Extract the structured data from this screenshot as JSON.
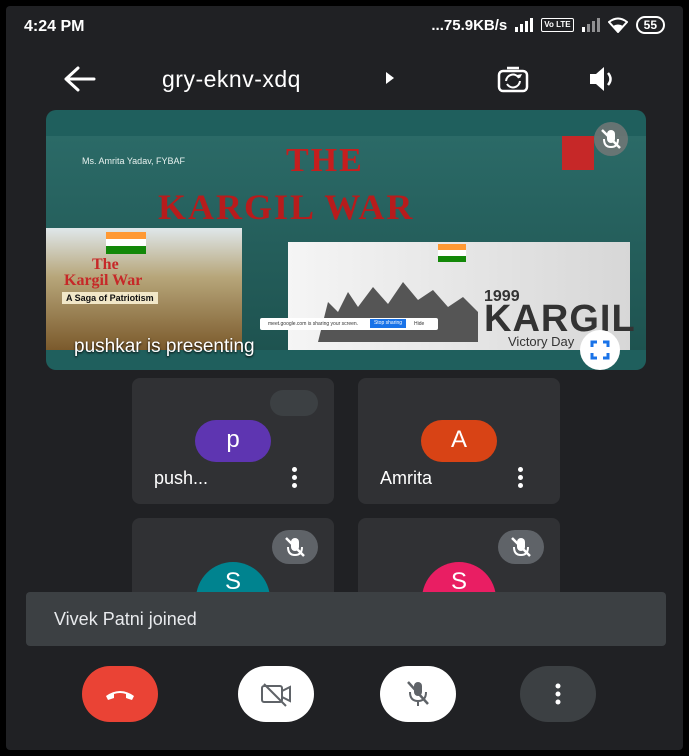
{
  "status_bar": {
    "time": "4:24 PM",
    "network_speed": "...75.9KB/s",
    "volte": "Vo LTE",
    "battery": "55"
  },
  "app_bar": {
    "meeting_code": "gry-eknv-xdq"
  },
  "presentation": {
    "slide_author": "Ms. Amrita Yadav, FYBAF",
    "slide_title_line1": "THE",
    "slide_title_line2": "KARGIL WAR",
    "poster_left_line1": "The",
    "poster_left_line2": "Kargil War",
    "poster_left_line3": "A Saga of Patriotism",
    "poster_right_year": "1999",
    "poster_right_title": "KARGIL",
    "poster_right_subtitle": "Victory Day",
    "share_bar_text": "meet.google.com is sharing your screen.",
    "share_bar_button": "Stop sharing",
    "share_bar_hide": "Hide",
    "presenting_label": "pushkar is presenting"
  },
  "participants": [
    {
      "initial": "p",
      "name": "push...",
      "color": "#5e35b1"
    },
    {
      "initial": "A",
      "name": "Amrita",
      "color": "#d84315"
    },
    {
      "initial": "S",
      "name": "",
      "color": "#00838f"
    },
    {
      "initial": "S",
      "name": "",
      "color": "#e91e63"
    }
  ],
  "toast": {
    "message": "Vivek Patni joined"
  },
  "icons": [
    "back-arrow-icon",
    "dropdown-caret-icon",
    "switch-camera-icon",
    "speaker-icon",
    "mic-off-icon",
    "fullscreen-icon",
    "more-vert-icon",
    "end-call-icon",
    "camera-off-icon"
  ],
  "colors": {
    "background": "#202124",
    "tile": "#303134",
    "end_call": "#ea4335",
    "toast": "#3c4043"
  }
}
